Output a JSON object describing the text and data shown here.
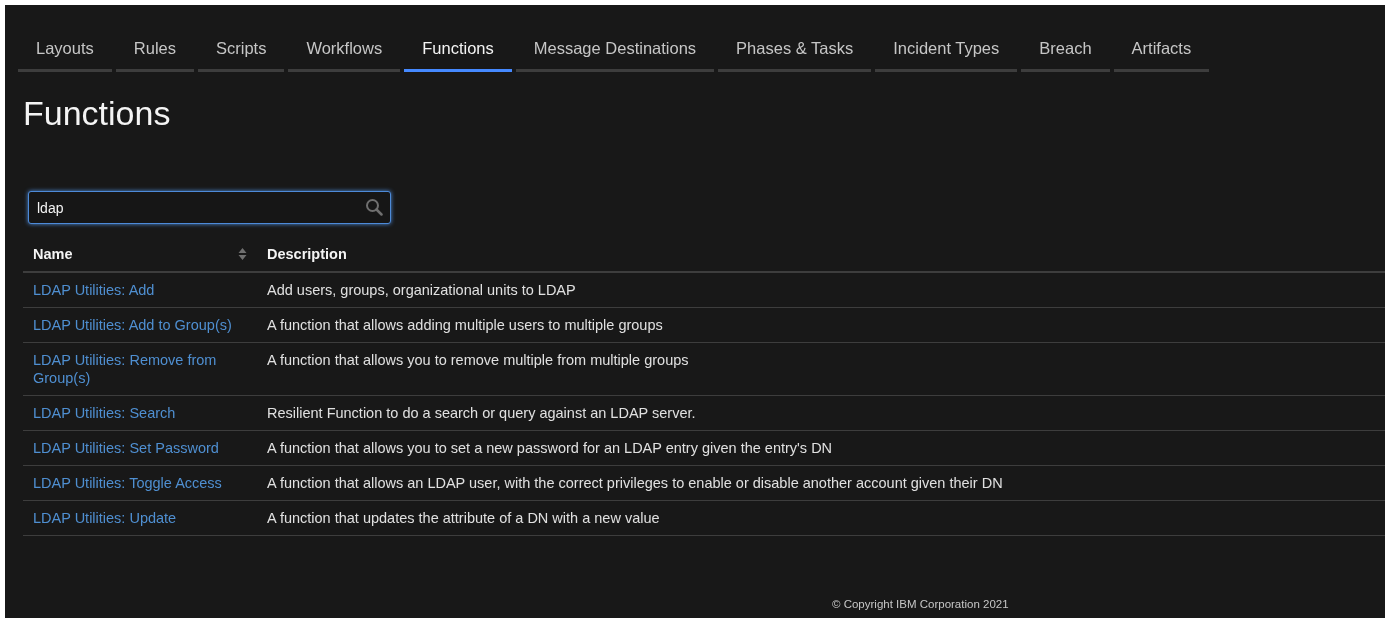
{
  "tabs": [
    {
      "label": "Layouts",
      "selected": false
    },
    {
      "label": "Rules",
      "selected": false
    },
    {
      "label": "Scripts",
      "selected": false
    },
    {
      "label": "Workflows",
      "selected": false
    },
    {
      "label": "Functions",
      "selected": true
    },
    {
      "label": "Message Destinations",
      "selected": false
    },
    {
      "label": "Phases & Tasks",
      "selected": false
    },
    {
      "label": "Incident Types",
      "selected": false
    },
    {
      "label": "Breach",
      "selected": false
    },
    {
      "label": "Artifacts",
      "selected": false
    }
  ],
  "page_title": "Functions",
  "search": {
    "value": "ldap"
  },
  "table": {
    "columns": [
      "Name",
      "Description"
    ],
    "rows": [
      {
        "name": "LDAP Utilities: Add",
        "description": "Add users, groups, organizational units to LDAP"
      },
      {
        "name": "LDAP Utilities: Add to Group(s)",
        "description": "A function that allows adding multiple users to multiple groups"
      },
      {
        "name": "LDAP Utilities: Remove from Group(s)",
        "description": "A function that allows you to remove multiple from multiple groups"
      },
      {
        "name": "LDAP Utilities: Search",
        "description": "Resilient Function to do a search or query against an LDAP server."
      },
      {
        "name": "LDAP Utilities: Set Password",
        "description": "A function that allows you to set a new password for an LDAP entry given the entry's DN"
      },
      {
        "name": "LDAP Utilities: Toggle Access",
        "description": "A function that allows an LDAP user, with the correct privileges to enable or disable another account given their DN"
      },
      {
        "name": "LDAP Utilities: Update",
        "description": "A function that updates the attribute of a DN with a new value"
      }
    ]
  },
  "footer": "© Copyright IBM Corporation 2021"
}
